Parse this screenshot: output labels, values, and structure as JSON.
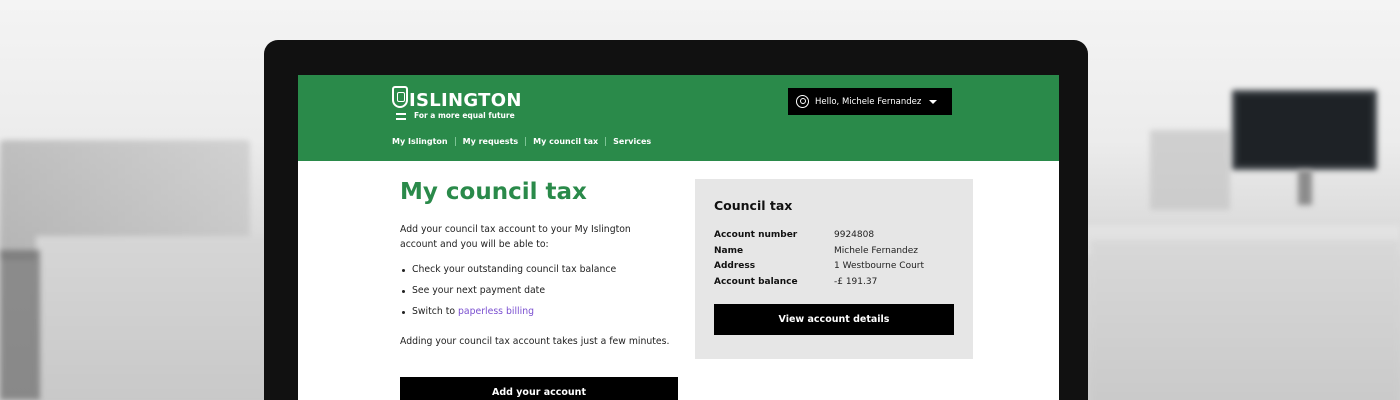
{
  "header": {
    "logo_text": "ISLINGTON",
    "tagline": "For a more equal future",
    "user_greeting": "Hello,  Michele Fernandez",
    "nav": [
      {
        "label": "My Islington"
      },
      {
        "label": "My requests"
      },
      {
        "label": "My council tax"
      },
      {
        "label": "Services"
      }
    ]
  },
  "main": {
    "title": "My council tax",
    "intro": "Add your council tax account to your My Islington account and you will be able to:",
    "bullets": [
      "Check your outstanding council tax balance",
      "See your next payment date"
    ],
    "bullet_switch_prefix": "Switch to ",
    "bullet_switch_link": "paperless billing",
    "outro": "Adding your council tax account takes just a few minutes.",
    "add_button": "Add your account"
  },
  "card": {
    "title": "Council tax",
    "fields": [
      {
        "label": "Account number",
        "value": "9924808"
      },
      {
        "label": "Name",
        "value": "Michele Fernandez"
      },
      {
        "label": "Address",
        "value": "1 Westbourne Court"
      },
      {
        "label": "Account balance",
        "value": "-£ 191.37"
      }
    ],
    "view_button": "View account details"
  },
  "colors": {
    "brand_green": "#2a8a4a",
    "button_black": "#000000",
    "link_purple": "#7a4fd0",
    "card_grey": "#e6e6e6"
  },
  "icons": [
    "crest-icon",
    "menu-icon",
    "user-circle-icon",
    "caret-down-icon"
  ]
}
